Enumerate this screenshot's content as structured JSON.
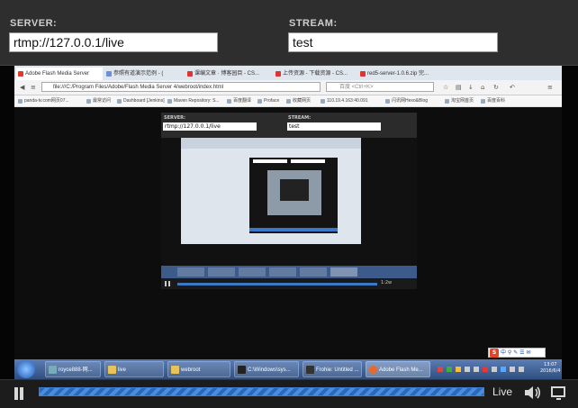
{
  "settings": {
    "server_label": "SERVER:",
    "server_value": "rtmp://127.0.0.1/live",
    "stream_label": "STREAM:",
    "stream_value": "test"
  },
  "browser": {
    "tabs": [
      {
        "label": "Adobe Flash Media Server",
        "icon_color": "#e03a2e"
      },
      {
        "label": "参照有道演示范例 - (",
        "icon_color": "#6c8fd6"
      },
      {
        "label": "课编文章 · 博客园目 - CS...",
        "icon_color": "#d33"
      },
      {
        "label": "上传资源 - 下载资源 - CS...",
        "icon_color": "#d33"
      },
      {
        "label": "red5-server-1.0.6.zip 完...",
        "icon_color": "#d33"
      }
    ],
    "url": "file:///C:/Program Files/Adobe/Flash Media Server 4/webroot/index.html",
    "search_placeholder": "百度 <Ctrl+K>",
    "bookmarks": [
      "panda-tv.com网页07...",
      "最常访问",
      "Dashboard [Jenkins]",
      "Maven Repository: S...",
      "百度翻译",
      "Proface",
      "收藏网页",
      "110.19.4.163:40.091",
      "闪讯网Hexo&Blog",
      "淘宝网首页",
      "百度百科"
    ]
  },
  "inner": {
    "server_label": "SERVER:",
    "server_value": "rtmp://127.0.0.1/live",
    "stream_label": "STREAM:",
    "stream_value": "test",
    "time": "1:2w"
  },
  "taskbar": {
    "items": [
      {
        "label": "royce888-网...",
        "icon_color": "#7ab"
      },
      {
        "label": "live",
        "icon_color": "#e8c35a"
      },
      {
        "label": "webroot",
        "icon_color": "#e8c35a"
      },
      {
        "label": "C:\\Windows\\sys...",
        "icon_color": "#222"
      },
      {
        "label": "Frohie: Untitled ...",
        "icon_color": "#333"
      },
      {
        "label": "Adobe Flash Me...",
        "icon_color": "#e86a2a"
      }
    ],
    "clock_time": "13:07",
    "clock_date": "2016/6/4"
  },
  "player": {
    "live_label": "Live",
    "progress": 1.0
  }
}
